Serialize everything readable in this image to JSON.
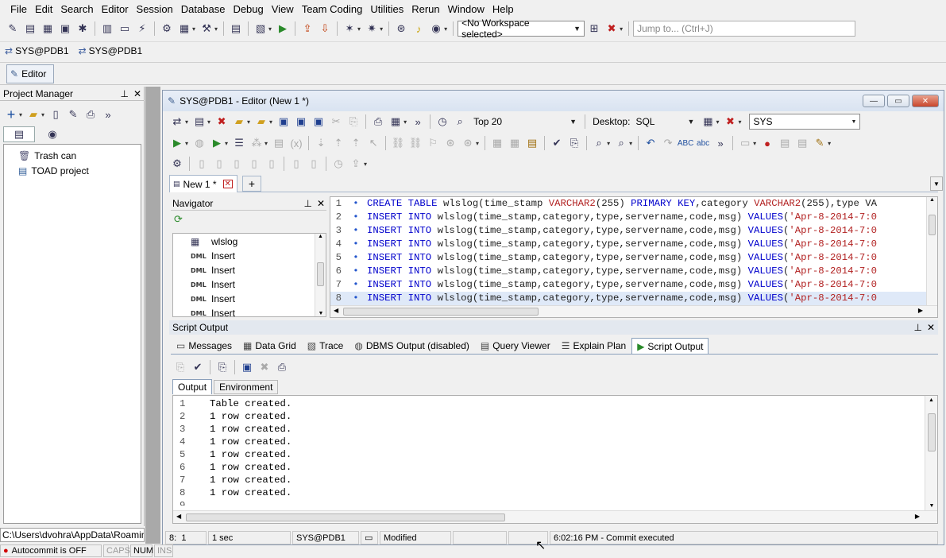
{
  "menubar": {
    "items": [
      "File",
      "Edit",
      "Search",
      "Editor",
      "Session",
      "Database",
      "Debug",
      "View",
      "Team Coding",
      "Utilities",
      "Rerun",
      "Window",
      "Help"
    ]
  },
  "toolbar": {
    "workspace": "<No Workspace selected>",
    "jump_placeholder": "Jump to... (Ctrl+J)"
  },
  "connections": [
    "SYS@PDB1",
    "SYS@PDB1"
  ],
  "editor_tab": {
    "label": "Editor"
  },
  "project_manager": {
    "title": "Project Manager",
    "tree": [
      {
        "label": "Trash can",
        "icon": "trash-can-icon"
      },
      {
        "label": "TOAD project",
        "icon": "project-icon"
      }
    ],
    "path": "C:\\Users\\dvohra\\AppData\\Roaming\\"
  },
  "editor_window": {
    "title": "SYS@PDB1 - Editor (New 1 *)",
    "top_n": "Top 20",
    "desktop_label": "Desktop:",
    "desktop_value": "SQL",
    "schema": "SYS",
    "doc_tab": "New 1 *",
    "code": [
      {
        "n": "1",
        "parts": [
          [
            "kw",
            "CREATE TABLE "
          ],
          [
            "tx",
            "wlslog(time_stamp "
          ],
          [
            "ty",
            "VARCHAR2"
          ],
          [
            "tx",
            "(255) "
          ],
          [
            "kw",
            "PRIMARY KEY"
          ],
          [
            "tx",
            ",category "
          ],
          [
            "ty",
            "VARCHAR2"
          ],
          [
            "tx",
            "(255),type VA"
          ]
        ]
      },
      {
        "n": "2",
        "parts": [
          [
            "kw",
            "INSERT INTO "
          ],
          [
            "tx",
            "wlslog(time_stamp,category,type,servername,code,msg) "
          ],
          [
            "kw",
            "VALUES"
          ],
          [
            "tx",
            "("
          ],
          [
            "st",
            "'Apr-8-2014-7:0"
          ]
        ]
      },
      {
        "n": "3",
        "parts": [
          [
            "kw",
            "INSERT INTO "
          ],
          [
            "tx",
            "wlslog(time_stamp,category,type,servername,code,msg) "
          ],
          [
            "kw",
            "VALUES"
          ],
          [
            "tx",
            "("
          ],
          [
            "st",
            "'Apr-8-2014-7:0"
          ]
        ]
      },
      {
        "n": "4",
        "parts": [
          [
            "kw",
            "INSERT INTO "
          ],
          [
            "tx",
            "wlslog(time_stamp,category,type,servername,code,msg) "
          ],
          [
            "kw",
            "VALUES"
          ],
          [
            "tx",
            "("
          ],
          [
            "st",
            "'Apr-8-2014-7:0"
          ]
        ]
      },
      {
        "n": "5",
        "parts": [
          [
            "kw",
            "INSERT INTO "
          ],
          [
            "tx",
            "wlslog(time_stamp,category,type,servername,code,msg) "
          ],
          [
            "kw",
            "VALUES"
          ],
          [
            "tx",
            "("
          ],
          [
            "st",
            "'Apr-8-2014-7:0"
          ]
        ]
      },
      {
        "n": "6",
        "parts": [
          [
            "kw",
            "INSERT INTO "
          ],
          [
            "tx",
            "wlslog(time_stamp,category,type,servername,code,msg) "
          ],
          [
            "kw",
            "VALUES"
          ],
          [
            "tx",
            "("
          ],
          [
            "st",
            "'Apr-8-2014-7:0"
          ]
        ]
      },
      {
        "n": "7",
        "parts": [
          [
            "kw",
            "INSERT INTO "
          ],
          [
            "tx",
            "wlslog(time_stamp,category,type,servername,code,msg) "
          ],
          [
            "kw",
            "VALUES"
          ],
          [
            "tx",
            "("
          ],
          [
            "st",
            "'Apr-8-2014-7:0"
          ]
        ]
      },
      {
        "n": "8",
        "parts": [
          [
            "kw",
            "INSERT INTO "
          ],
          [
            "tx",
            "wlslog(time_stamp,category,type,servername,code,msg) "
          ],
          [
            "kw",
            "VALUES"
          ],
          [
            "tx",
            "("
          ],
          [
            "st",
            "'Apr-8-2014-7:0"
          ]
        ]
      }
    ]
  },
  "navigator": {
    "title": "Navigator",
    "items": [
      {
        "label": "wlslog",
        "tag": ""
      },
      {
        "label": "Insert",
        "tag": "DML"
      },
      {
        "label": "Insert",
        "tag": "DML"
      },
      {
        "label": "Insert",
        "tag": "DML"
      },
      {
        "label": "Insert",
        "tag": "DML"
      },
      {
        "label": "Insert",
        "tag": "DML"
      }
    ]
  },
  "script_output": {
    "title": "Script Output",
    "tabs": [
      "Messages",
      "Data Grid",
      "Trace",
      "DBMS Output (disabled)",
      "Query Viewer",
      "Explain Plan",
      "Script Output"
    ],
    "subtabs": [
      "Output",
      "Environment"
    ],
    "lines": [
      {
        "n": "1",
        "text": "Table created."
      },
      {
        "n": "2",
        "text": "1 row created."
      },
      {
        "n": "3",
        "text": "1 row created."
      },
      {
        "n": "4",
        "text": "1 row created."
      },
      {
        "n": "5",
        "text": "1 row created."
      },
      {
        "n": "6",
        "text": "1 row created."
      },
      {
        "n": "7",
        "text": "1 row created."
      },
      {
        "n": "8",
        "text": "1 row created."
      },
      {
        "n": "9",
        "text": ""
      }
    ]
  },
  "status": {
    "position": "8:",
    "col": "1",
    "elapsed": "1 sec",
    "connection": "SYS@PDB1",
    "modified": "Modified",
    "message": "6:02:16 PM - Commit executed"
  },
  "bottom": {
    "autocommit": "Autocommit is OFF",
    "caps": "CAPS",
    "num": "NUM",
    "ins": "INS"
  },
  "colors": {
    "keyword": "#0000cc",
    "type": "#b22222",
    "autocommit_dot": "#d00000"
  }
}
